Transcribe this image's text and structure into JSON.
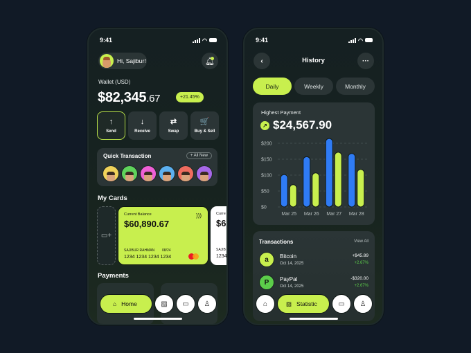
{
  "colors": {
    "accent": "#c8ef4e",
    "blue": "#2f7bf5",
    "positive": "#5ccd4a",
    "background": "#111a26"
  },
  "status_bar": {
    "time": "9:41"
  },
  "home": {
    "greeting": "Hi, Sajibur!",
    "wallet_label": "Wallet (USD)",
    "balance_main": "$82,345",
    "balance_cents": ".67",
    "change": "+21.45%",
    "actions": [
      {
        "label": "Send",
        "icon": "arrow-up-icon",
        "glyph": "↑",
        "selected": true
      },
      {
        "label": "Receive",
        "icon": "arrow-down-icon",
        "glyph": "↓",
        "selected": false
      },
      {
        "label": "Swap",
        "icon": "swap-icon",
        "glyph": "⇄",
        "selected": false
      },
      {
        "label": "Buy & Sell",
        "icon": "cart-icon",
        "glyph": "🛒",
        "selected": false
      }
    ],
    "quick_transaction": {
      "title": "Quick Transaction",
      "all_new": "+ All New",
      "contact_colors": [
        "#f0d25a",
        "#5fd35b",
        "#ef5fd6",
        "#5cb0f0",
        "#ef6c5f",
        "#a768e8"
      ]
    },
    "my_cards_title": "My Cards",
    "cards": [
      {
        "label": "Current Balance",
        "balance": "$60,890.67",
        "holder": "SAJIBUR RAHMAN",
        "expiry": "08/24",
        "number": "1234 1234 1234 1234"
      },
      {
        "label": "Curre",
        "balance": "$6",
        "holder": "SAJIB",
        "number": "1234"
      }
    ],
    "payments_title": "Payments",
    "nav": {
      "home_label": "Home"
    }
  },
  "history": {
    "title": "History",
    "tabs": [
      {
        "label": "Daily",
        "selected": true
      },
      {
        "label": "Weekly",
        "selected": false
      },
      {
        "label": "Monthly",
        "selected": false
      }
    ],
    "highest_label": "Highest Payment",
    "highest_amount": "$24,567.90",
    "transactions_title": "Transactions",
    "view_all": "View All",
    "transactions": [
      {
        "name": "Bitcoin",
        "date": "Oct 14, 2025",
        "amount": "+$45.89",
        "change": "+2.67%",
        "logo": "a",
        "logo_color": "#c8ef4e"
      },
      {
        "name": "PayPal",
        "date": "Oct 14, 2025",
        "amount": "-$320.00",
        "change": "+2.67%",
        "logo": "P",
        "logo_color": "#5ccd4a"
      }
    ],
    "nav": {
      "statistic_label": "Statistic"
    }
  },
  "chart_data": {
    "type": "bar",
    "title": "Highest Payment",
    "categories": [
      "Mar 25",
      "Mar 26",
      "Mar 27",
      "Mar 28"
    ],
    "series": [
      {
        "name": "series-blue",
        "color": "#2f7bf5",
        "values": [
          102,
          158,
          215,
          168
        ]
      },
      {
        "name": "series-lime",
        "color": "#c8ef4e",
        "values": [
          70,
          107,
          172,
          118
        ]
      }
    ],
    "yticks": [
      "$0",
      "$50",
      "$100",
      "$150",
      "$200"
    ],
    "ylim": [
      0,
      215
    ],
    "grid": true,
    "xlabel": "",
    "ylabel": ""
  }
}
